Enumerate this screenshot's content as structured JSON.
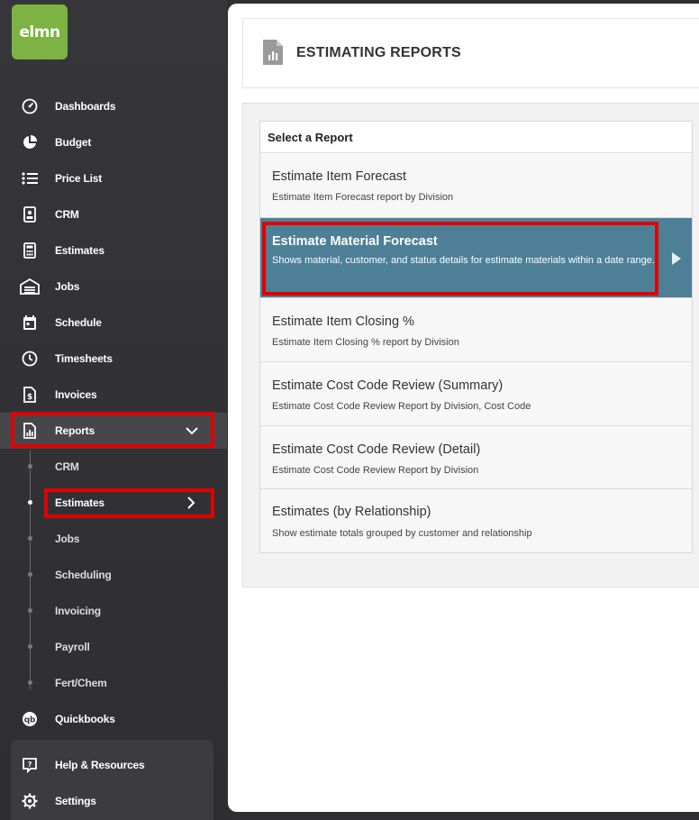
{
  "logo": {
    "text": "elmn"
  },
  "sidebar": {
    "items": [
      {
        "label": "Dashboards",
        "icon": "dashboard-gauge-icon"
      },
      {
        "label": "Budget",
        "icon": "pie-chart-icon"
      },
      {
        "label": "Price List",
        "icon": "list-icon"
      },
      {
        "label": "CRM",
        "icon": "contact-card-icon"
      },
      {
        "label": "Estimates",
        "icon": "calculator-icon"
      },
      {
        "label": "Jobs",
        "icon": "garage-icon"
      },
      {
        "label": "Schedule",
        "icon": "calendar-icon"
      },
      {
        "label": "Timesheets",
        "icon": "clock-icon"
      },
      {
        "label": "Invoices",
        "icon": "invoice-dollar-icon"
      },
      {
        "label": "Reports",
        "icon": "report-chart-icon"
      }
    ],
    "reports_sub": [
      {
        "label": "CRM"
      },
      {
        "label": "Estimates"
      },
      {
        "label": "Jobs"
      },
      {
        "label": "Scheduling"
      },
      {
        "label": "Invoicing"
      },
      {
        "label": "Payroll"
      },
      {
        "label": "Fert/Chem"
      }
    ],
    "quickbooks": {
      "label": "Quickbooks",
      "icon": "quickbooks-icon"
    },
    "bottom": [
      {
        "label": "Help & Resources",
        "icon": "help-icon"
      },
      {
        "label": "Settings",
        "icon": "gear-icon"
      }
    ]
  },
  "header": {
    "title": "ESTIMATING REPORTS",
    "icon": "document-chart-icon"
  },
  "report_list": {
    "heading": "Select a Report",
    "rows": [
      {
        "title": "Estimate Item Forecast",
        "desc": "Estimate Item Forecast report by Division"
      },
      {
        "title": "Estimate Material Forecast",
        "desc": "Shows material, customer, and status details for estimate materials within a date range."
      },
      {
        "title": "Estimate Item Closing %",
        "desc": "Estimate Item Closing % report by Division"
      },
      {
        "title": "Estimate Cost Code Review (Summary)",
        "desc": "Estimate Cost Code Review Report by Division, Cost Code"
      },
      {
        "title": "Estimate Cost Code Review (Detail)",
        "desc": "Estimate Cost Code Review Report by Division"
      },
      {
        "title": "Estimates (by Relationship)",
        "desc": "Show estimate totals grouped by customer and relationship"
      }
    ]
  },
  "colors": {
    "accent": "#4d7f97",
    "logo": "#7cb342",
    "highlight": "#e00000",
    "sidebar": "#2f2f33"
  }
}
